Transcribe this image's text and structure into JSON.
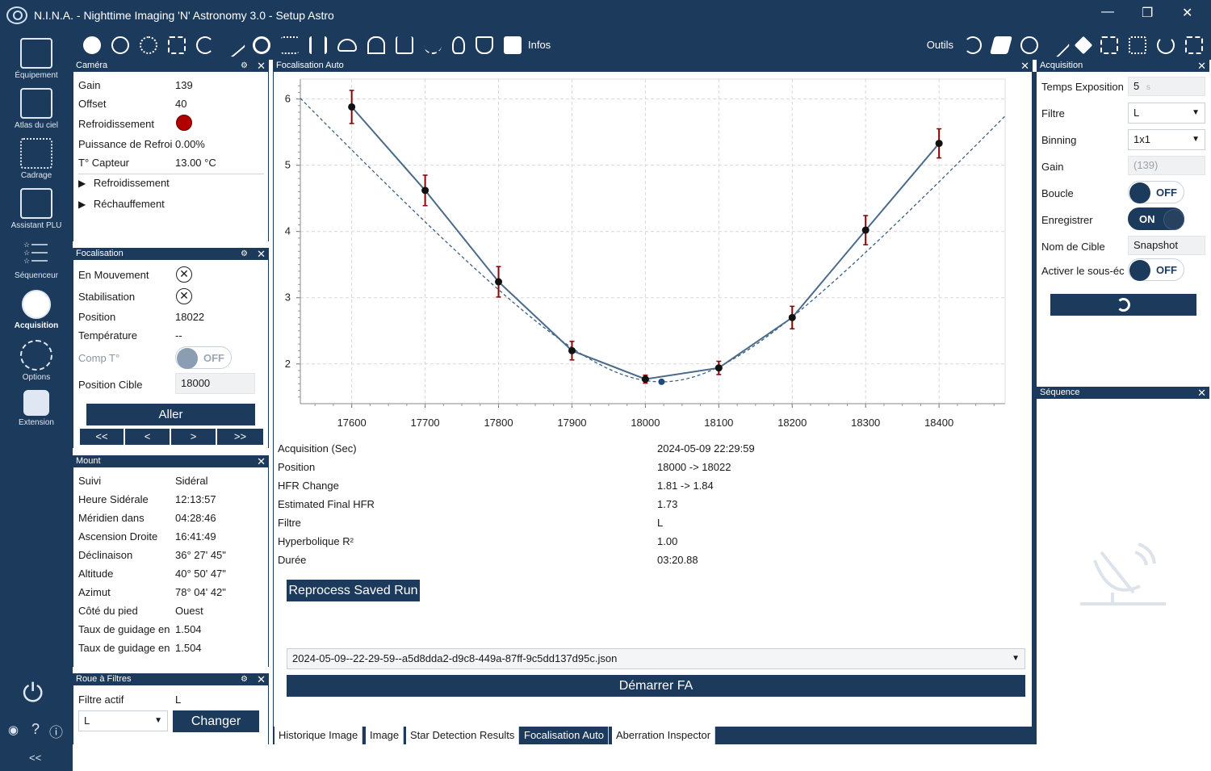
{
  "window": {
    "title": "N.I.N.A. - Nighttime Imaging 'N' Astronomy 3.0  -  Setup Astro",
    "minimize": "—",
    "restore": "❐",
    "close": "✕"
  },
  "sidebar": {
    "items": [
      {
        "label": "Équipement",
        "icon": "telescope-icon"
      },
      {
        "label": "Atlas du ciel",
        "icon": "star-map-icon"
      },
      {
        "label": "Cadrage",
        "icon": "framing-icon"
      },
      {
        "label": "Assistant PLU",
        "icon": "flat-wizard-icon"
      },
      {
        "label": "Séquenceur",
        "icon": "sequencer-icon"
      },
      {
        "label": "Acquisition",
        "icon": "imaging-icon"
      },
      {
        "label": "Options",
        "icon": "gears-icon"
      },
      {
        "label": "Extension",
        "icon": "puzzle-icon"
      }
    ],
    "power_icon": "⏻",
    "footer_eye": "◉",
    "footer_help": "?",
    "footer_info": "ⓘ",
    "collapse": "<<"
  },
  "toolbar": {
    "infos_label": "Infos",
    "outils_label": "Outils"
  },
  "camera": {
    "title": "Caméra",
    "rows": [
      {
        "label": "Gain",
        "value": "139"
      },
      {
        "label": "Offset",
        "value": "40"
      },
      {
        "label": "Refroidissement",
        "value": ""
      },
      {
        "label": "Puissance de Refroic",
        "value": "0.00%"
      },
      {
        "label": "T° Capteur",
        "value": "13.00 °C"
      }
    ],
    "expand_cooling": "Refroidissement",
    "expand_warming": "Réchauffement"
  },
  "focuser": {
    "title": "Focalisation",
    "moving_label": "En Mouvement",
    "settling_label": "Stabilisation",
    "position_label": "Position",
    "position_value": "18022",
    "temperature_label": "Température",
    "temperature_value": "--",
    "comp_label": "Comp T°",
    "comp_toggle": "OFF",
    "target_label": "Position Cible",
    "target_value": "18000",
    "goto_button": "Aller",
    "step_buttons": [
      "<<",
      "<",
      ">",
      ">>"
    ]
  },
  "mount": {
    "title": "Mount",
    "rows": [
      {
        "label": "Suivi",
        "value": "Sidéral"
      },
      {
        "label": "Heure Sidérale",
        "value": "12:13:57"
      },
      {
        "label": "Méridien dans",
        "value": "04:28:46"
      },
      {
        "label": "Ascension Droite",
        "value": "16:41:49"
      },
      {
        "label": "Déclinaison",
        "value": "36° 27' 45\""
      },
      {
        "label": "Altitude",
        "value": "40° 50' 47\""
      },
      {
        "label": "Azimut",
        "value": "78° 04' 42\""
      },
      {
        "label": "Côté du pied",
        "value": "Ouest"
      },
      {
        "label": "Taux de guidage en",
        "value": "1.504"
      },
      {
        "label": "Taux de guidage en",
        "value": "1.504"
      }
    ]
  },
  "filterwheel": {
    "title": "Roue à Filtres",
    "active_label": "Filtre actif",
    "active_value": "L",
    "selected": "L",
    "change_button": "Changer"
  },
  "autofocus": {
    "title": "Focalisation Auto",
    "info": [
      {
        "label": "Acquisition (Sec)",
        "value": "2024-05-09 22:29:59"
      },
      {
        "label": "Position",
        "value": "18000 -> 18022"
      },
      {
        "label": "HFR Change",
        "value": "1.81 -> 1.84"
      },
      {
        "label": "Estimated Final HFR",
        "value": "1.73"
      },
      {
        "label": "Filtre",
        "value": "L"
      },
      {
        "label": "Hyperbolique R²",
        "value": "1.00"
      },
      {
        "label": "Durée",
        "value": "03:20.88"
      }
    ],
    "reprocess_button": "Reprocess Saved Run",
    "saved_run": "2024-05-09--22-29-59--a5d8dda2-d9c8-449a-87ff-9c5dd137d95c.json",
    "start_button": "Démarrer FA"
  },
  "chart_data": {
    "type": "scatter",
    "x_ticks": [
      "17600",
      "17700",
      "17800",
      "17900",
      "18000",
      "18100",
      "18200",
      "18300",
      "18400"
    ],
    "y_ticks": [
      "2",
      "3",
      "4",
      "5",
      "6"
    ],
    "xlim": [
      17530,
      18490
    ],
    "ylim": [
      1.4,
      6.3
    ],
    "grid": true,
    "points": [
      {
        "x": 17600,
        "y": 5.88,
        "err": 0.25
      },
      {
        "x": 17700,
        "y": 4.62,
        "err": 0.23
      },
      {
        "x": 17800,
        "y": 3.24,
        "err": 0.23
      },
      {
        "x": 17900,
        "y": 2.2,
        "err": 0.14
      },
      {
        "x": 18000,
        "y": 1.77,
        "err": 0.06
      },
      {
        "x": 18100,
        "y": 1.94,
        "err": 0.1
      },
      {
        "x": 18200,
        "y": 2.7,
        "err": 0.17
      },
      {
        "x": 18300,
        "y": 4.02,
        "err": 0.22
      },
      {
        "x": 18400,
        "y": 5.33,
        "err": 0.22
      }
    ],
    "final_point": {
      "x": 18022,
      "y": 1.73
    },
    "fit_curve": {
      "type": "hyperbolic",
      "min_x": 18022,
      "min_y": 1.73
    },
    "colors": {
      "line": "#4a6a8a",
      "fit": "#3c5f83",
      "error": "#8b0000",
      "point": "#111111"
    }
  },
  "bottom_tabs": [
    "Historique Image",
    "Image",
    "Star Detection Results",
    "Focalisation Auto",
    "Aberration Inspector"
  ],
  "imaging": {
    "title": "Acquisition",
    "exposure_label": "Temps Exposition",
    "exposure_value": "5",
    "exposure_unit": "s",
    "filter_label": "Filtre",
    "filter_value": "L",
    "binning_label": "Binning",
    "binning_value": "1x1",
    "gain_label": "Gain",
    "gain_value": "(139)",
    "loop_label": "Boucle",
    "loop_toggle": "OFF",
    "save_label": "Enregistrer",
    "save_toggle": "ON",
    "target_label": "Nom de Cible",
    "target_value": "Snapshot",
    "subsample_label": "Activer le sous-éc",
    "subsample_toggle": "OFF"
  },
  "sequence": {
    "title": "Séquence"
  }
}
